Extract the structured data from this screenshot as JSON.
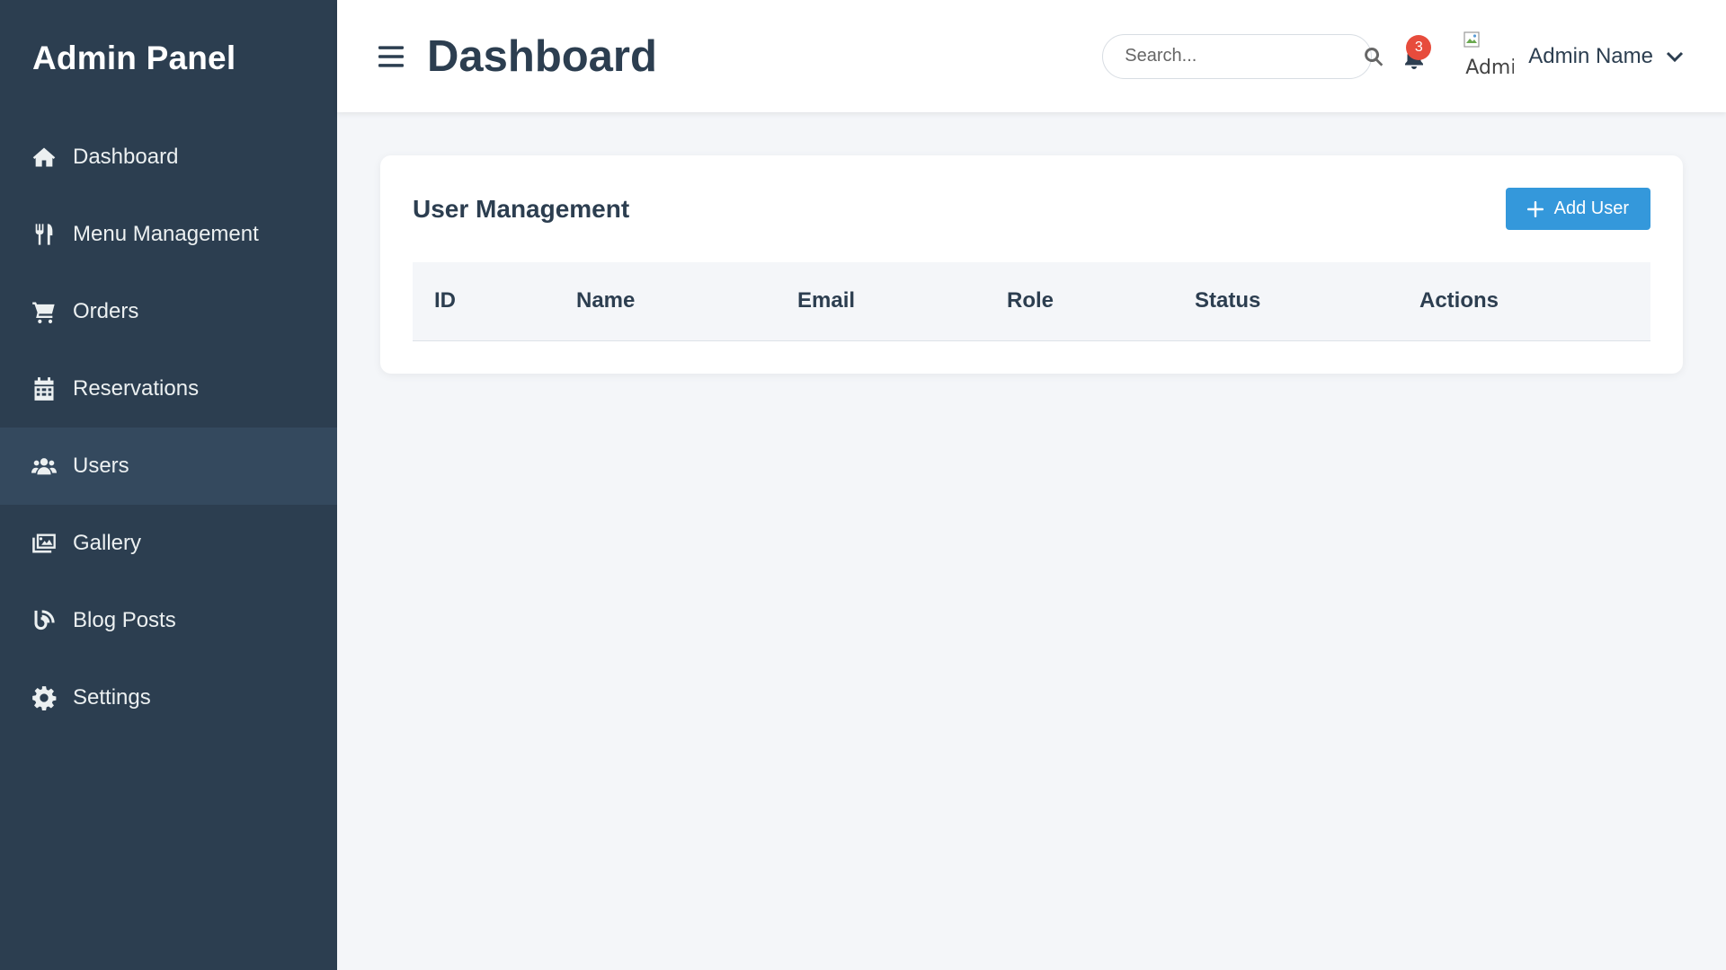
{
  "sidebar": {
    "title": "Admin Panel",
    "items": [
      {
        "label": "Dashboard",
        "icon": "home-icon"
      },
      {
        "label": "Menu Management",
        "icon": "utensils-icon"
      },
      {
        "label": "Orders",
        "icon": "cart-icon"
      },
      {
        "label": "Reservations",
        "icon": "calendar-icon"
      },
      {
        "label": "Users",
        "icon": "users-icon",
        "active": true
      },
      {
        "label": "Gallery",
        "icon": "images-icon"
      },
      {
        "label": "Blog Posts",
        "icon": "blog-icon"
      },
      {
        "label": "Settings",
        "icon": "gear-icon"
      }
    ]
  },
  "header": {
    "title": "Dashboard",
    "search_placeholder": "Search...",
    "notification_count": "3",
    "avatar_alt": "Admi",
    "user_name": "Admin Name"
  },
  "main": {
    "card_title": "User Management",
    "add_button_label": "Add User",
    "table": {
      "columns": [
        "ID",
        "Name",
        "Email",
        "Role",
        "Status",
        "Actions"
      ],
      "rows": []
    }
  },
  "colors": {
    "sidebar_bg": "#2c3e50",
    "sidebar_active": "#34495e",
    "accent": "#3498db",
    "badge": "#e74c3c",
    "page_bg": "#f4f6f9"
  }
}
